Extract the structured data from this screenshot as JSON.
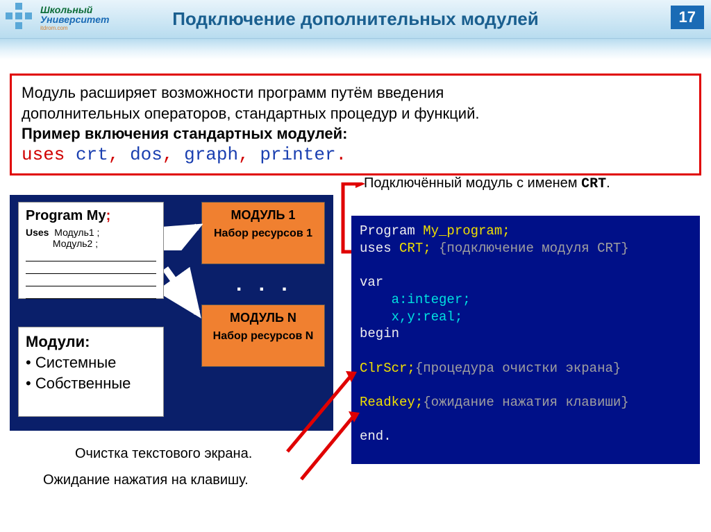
{
  "header": {
    "logo_top": "Школьный",
    "logo_bot": "Университет",
    "logo_sub": "itdrom.com",
    "title": "Подключение дополнительных модулей",
    "page_number": "17"
  },
  "intro": {
    "line1": "Модуль расширяет возможности программ путём введения",
    "line2": "дополнительных операторов, стандартных процедур и функций.",
    "line3": "Пример включения стандартных модулей:",
    "code_uses": "uses",
    "code_m1": "crt",
    "code_m2": "dos",
    "code_m3": "graph",
    "code_m4": "printer",
    "comma": ",",
    "dot": "."
  },
  "diagram": {
    "card1_title_a": "Program My",
    "card1_title_b": ";",
    "card1_uses_kw": "Uses",
    "card1_uses_l1": "Модуль1 ;",
    "card1_uses_l2": "Модуль2 ;",
    "mod1_title": "МОДУЛЬ 1",
    "mod1_sub": "Набор ресурсов 1",
    "dots": ". . .",
    "modn_title": "МОДУЛЬ N",
    "modn_sub": "Набор ресурсов N",
    "card2_title": "Модули:",
    "card2_li1": "• Системные",
    "card2_li2": "• Собственные"
  },
  "annotations": {
    "crt_pre": "Подключённый модуль с именем ",
    "crt_name": "CRT",
    "crt_post": ".",
    "clear": "Очистка текстового экрана.",
    "wait": "Ожидание нажатия на клавишу."
  },
  "code": {
    "l1a": "Program ",
    "l1b": "My_program;",
    "l2a": "uses ",
    "l2b": "CRT; ",
    "l2c": "{подключение модуля CRT}",
    "l3": "",
    "l4": "var",
    "l5": "    a:integer;",
    "l6": "    x,y:real;",
    "l7": "begin",
    "l8": "",
    "l9a": "ClrScr;",
    "l9b": "{процедура очистки экрана}",
    "l10": "",
    "l11a": "Readkey;",
    "l11b": "{ожидание нажатия клавиши}",
    "l12": "",
    "l13": "end."
  }
}
